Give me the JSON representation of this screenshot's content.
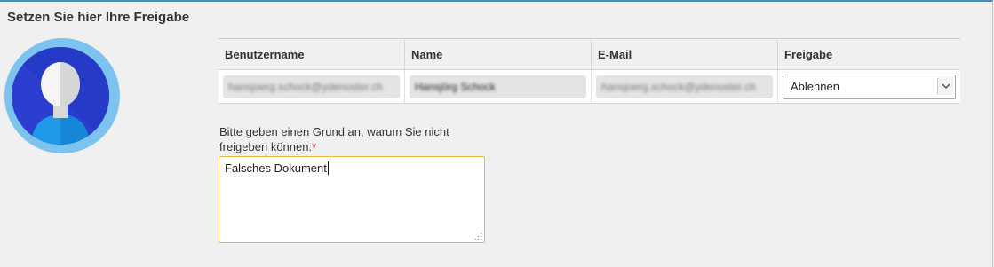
{
  "panel": {
    "title": "Setzen Sie hier Ihre Freigabe"
  },
  "table": {
    "headers": {
      "username": "Benutzername",
      "name": "Name",
      "email": "E-Mail",
      "release": "Freigabe"
    },
    "row": {
      "username": "hansjoerg.schock@ydenoster.ch",
      "name": "Hansjörg Schock",
      "email": "hansjoerg.schock@ydenoster.ch",
      "release_selected": "Ablehnen"
    }
  },
  "reason": {
    "label_line1": "Bitte geben einen Grund an, warum Sie nicht",
    "label_line2": "freigeben können:",
    "required_mark": "*",
    "value": "Falsches Dokument"
  },
  "colors": {
    "accent": "#3a8fc5",
    "required": "#d9262b",
    "focus_border": "#e6b84a",
    "avatar_outer": "#7cc4ef",
    "avatar_inner": "#2b3ecf"
  },
  "icons": {
    "avatar": "user-avatar-icon",
    "select_arrow": "chevron-down-icon",
    "resize": "resize-grip-icon"
  }
}
